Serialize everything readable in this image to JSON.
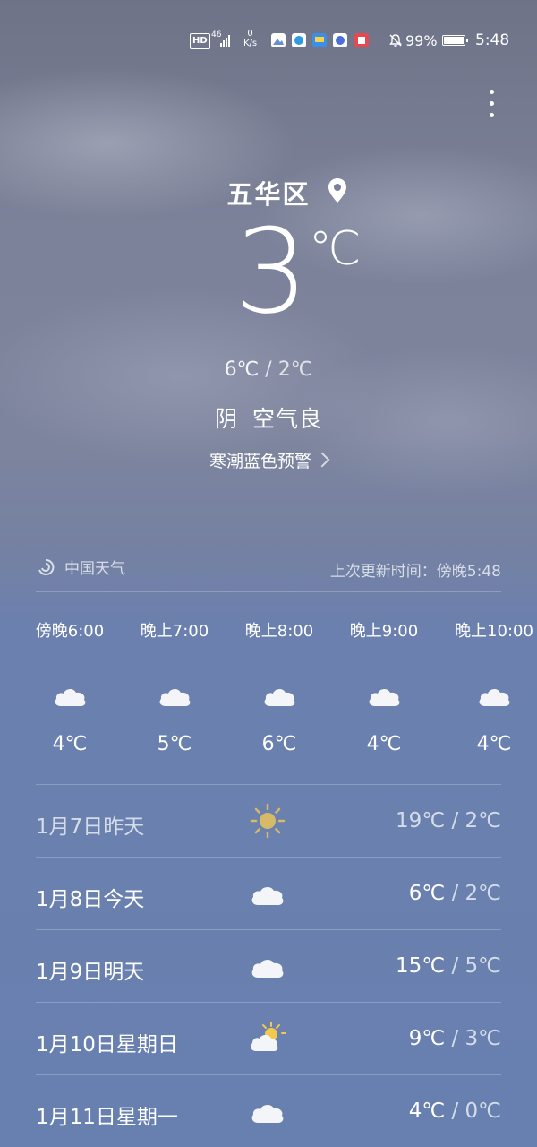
{
  "status_bar": {
    "hd": "HD",
    "signal": "46",
    "net_speed_value": "0",
    "net_speed_unit": "K/s",
    "battery_pct": "99%",
    "time": "5:48"
  },
  "location": {
    "city": "五华区"
  },
  "current": {
    "temp": "3",
    "unit": "℃",
    "high": "6℃",
    "low": "2℃",
    "sep": "/",
    "condition": "阴",
    "air_quality": "空气良",
    "alert": "寒潮蓝色预警"
  },
  "source": {
    "name": "中国天气",
    "updated": "上次更新时间：傍晚5:48"
  },
  "hourly": [
    {
      "time": "傍晚6:00",
      "icon": "cloudy-icon",
      "temp": "4℃"
    },
    {
      "time": "晚上7:00",
      "icon": "cloudy-icon",
      "temp": "5℃"
    },
    {
      "time": "晚上8:00",
      "icon": "cloudy-icon",
      "temp": "6℃"
    },
    {
      "time": "晚上9:00",
      "icon": "cloudy-icon",
      "temp": "4℃"
    },
    {
      "time": "晚上10:00",
      "icon": "cloudy-icon",
      "temp": "4℃"
    }
  ],
  "daily": [
    {
      "label": "1月7日昨天",
      "icon": "sunny-icon",
      "high": "19℃",
      "sep": "/",
      "low": "2℃"
    },
    {
      "label": "1月8日今天",
      "icon": "cloudy-icon",
      "high": "6℃",
      "sep": "/",
      "low": "2℃"
    },
    {
      "label": "1月9日明天",
      "icon": "cloudy-icon",
      "high": "15℃",
      "sep": "/",
      "low": "5℃"
    },
    {
      "label": "1月10日星期日",
      "icon": "partly-cloudy-icon",
      "high": "9℃",
      "sep": "/",
      "low": "3℃"
    },
    {
      "label": "1月11日星期一",
      "icon": "cloudy-icon",
      "high": "4℃",
      "sep": "/",
      "low": "0℃"
    }
  ],
  "colors": {
    "sky_top": "#6f7388",
    "sky_bottom": "#6880b0",
    "sun": "#f2c94c"
  }
}
